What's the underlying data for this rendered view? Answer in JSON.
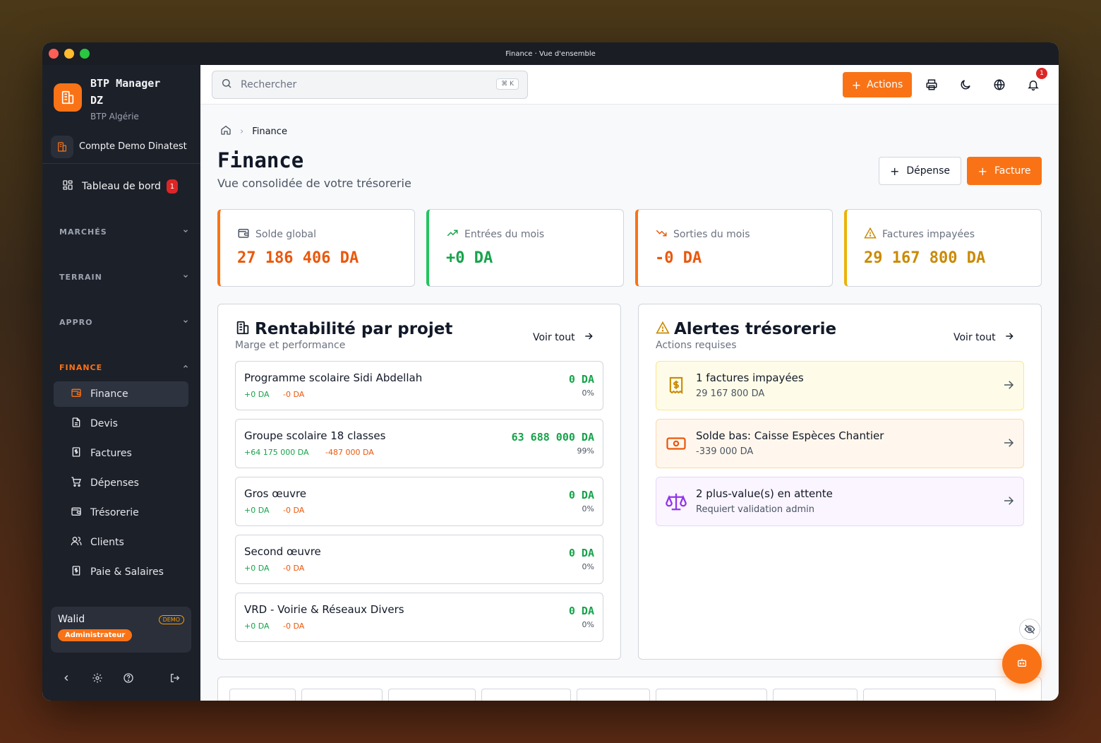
{
  "window": {
    "title": "Finance · Vue d'ensemble"
  },
  "brand": {
    "name": "BTP Manager DZ",
    "subtitle": "BTP Algérie"
  },
  "account": {
    "name": "Compte Demo Dinatest"
  },
  "nav": {
    "dashboard": {
      "label": "Tableau de bord",
      "badge": "1"
    },
    "sections": [
      {
        "label": "MARCHÉS"
      },
      {
        "label": "TERRAIN"
      },
      {
        "label": "APPRO"
      },
      {
        "label": "FINANCE"
      }
    ],
    "finance_items": [
      {
        "label": "Finance",
        "icon": "wallet-icon"
      },
      {
        "label": "Devis",
        "icon": "file-icon"
      },
      {
        "label": "Factures",
        "icon": "receipt-icon"
      },
      {
        "label": "Dépenses",
        "icon": "cart-icon"
      },
      {
        "label": "Trésorerie",
        "icon": "wallet-icon"
      },
      {
        "label": "Clients",
        "icon": "users-icon"
      },
      {
        "label": "Paie & Salaires",
        "icon": "receipt-icon"
      }
    ]
  },
  "user": {
    "name": "Walid",
    "badge": "DEMO",
    "role": "Administrateur"
  },
  "topbar": {
    "search_placeholder": "Rechercher",
    "shortcut": "⌘ K",
    "actions_label": "Actions",
    "notif_count": "1"
  },
  "breadcrumb": {
    "current": "Finance"
  },
  "page": {
    "title": "Finance",
    "subtitle": "Vue consolidée de votre trésorerie",
    "btn_expense": "Dépense",
    "btn_invoice": "Facture"
  },
  "kpis": [
    {
      "label": "Solde global",
      "value": "27 186 406 DA",
      "color": "#ea580c"
    },
    {
      "label": "Entrées du mois",
      "value": "+0 DA",
      "color": "#16a34a"
    },
    {
      "label": "Sorties du mois",
      "value": "-0 DA",
      "color": "#ea580c"
    },
    {
      "label": "Factures impayées",
      "value": "29 167 800 DA",
      "color": "#ca8a04"
    }
  ],
  "profit": {
    "title": "Rentabilité par projet",
    "subtitle": "Marge et performance",
    "see_all": "Voir tout",
    "projects": [
      {
        "name": "Programme scolaire Sidi Abdellah",
        "in": "+0 DA",
        "out": "-0 DA",
        "value": "0 DA",
        "pct": "0%"
      },
      {
        "name": "Groupe scolaire 18 classes",
        "in": "+64 175 000 DA",
        "out": "-487 000 DA",
        "value": "63 688 000 DA",
        "pct": "99%"
      },
      {
        "name": "Gros œuvre",
        "in": "+0 DA",
        "out": "-0 DA",
        "value": "0 DA",
        "pct": "0%"
      },
      {
        "name": "Second œuvre",
        "in": "+0 DA",
        "out": "-0 DA",
        "value": "0 DA",
        "pct": "0%"
      },
      {
        "name": "VRD - Voirie & Réseaux Divers",
        "in": "+0 DA",
        "out": "-0 DA",
        "value": "0 DA",
        "pct": "0%"
      }
    ]
  },
  "alerts": {
    "title": "Alertes trésorerie",
    "subtitle": "Actions requises",
    "see_all": "Voir tout",
    "items": [
      {
        "title": "1 factures impayées",
        "sub": "29 167 800 DA",
        "icon": "receipt-dollar-icon",
        "bg": "#fefce8",
        "border": "#fde68a",
        "color": "#ca8a04"
      },
      {
        "title": "Solde bas: Caisse Espèces Chantier",
        "sub": "-339 000 DA",
        "icon": "cash-icon",
        "bg": "#fff7ed",
        "border": "#fed7aa",
        "color": "#ea580c"
      },
      {
        "title": "2 plus-value(s) en attente",
        "sub": "Requiert validation admin",
        "icon": "scale-icon",
        "bg": "#faf5ff",
        "border": "#e9d5ff",
        "color": "#9333ea"
      }
    ]
  }
}
